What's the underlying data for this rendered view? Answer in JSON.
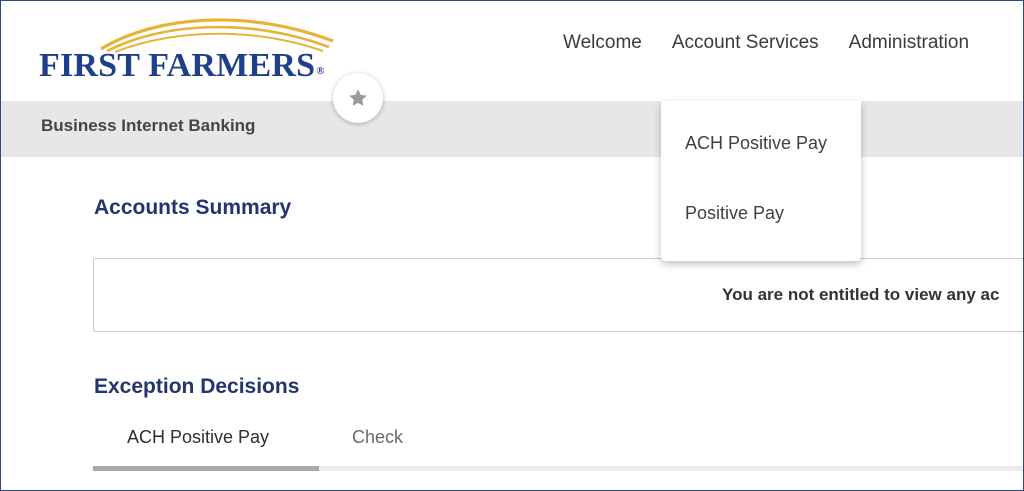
{
  "brand": {
    "logo_text": "FIRST FARMERS",
    "logo_registered": "®",
    "logo_arc_color": "#e5b53a",
    "logo_text_color": "#1f3f8a"
  },
  "nav": {
    "items": [
      "Welcome",
      "Account Services",
      "Administration"
    ]
  },
  "subheader": {
    "title": "Business Internet Banking",
    "favorite_icon": "star-icon"
  },
  "account_services_menu": {
    "items": [
      "ACH Positive Pay",
      "Positive Pay"
    ]
  },
  "accounts_summary": {
    "title": "Accounts Summary",
    "notice": "You are not entitled to view any ac"
  },
  "exception_decisions": {
    "title": "Exception Decisions",
    "tabs": [
      "ACH Positive Pay",
      "Check"
    ],
    "active_tab": "ACH Positive Pay"
  },
  "colors": {
    "heading": "#23356e",
    "subbar_bg": "#e7e7e7",
    "frame_border": "#2e4a7a"
  }
}
